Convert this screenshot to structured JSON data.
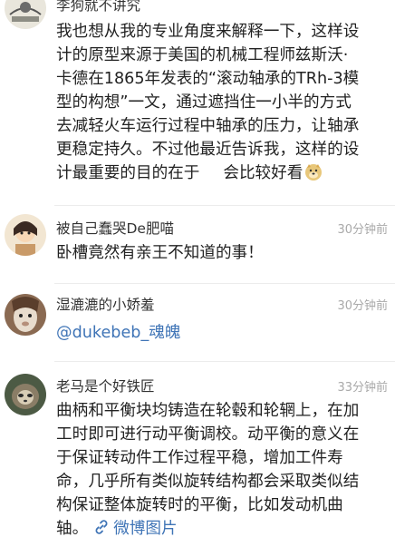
{
  "comments": [
    {
      "user": "李狗就不讲究",
      "lines": [
        "我也想从我的专业角度来解释一下，这样设",
        "计的原型来源于美国的机械工程师兹斯沃·",
        "卡德在1865年发表的“滚动轴承的TRh-3模",
        "型的构想”一文，通过遮挡住一小半的方式",
        "去减轻火车运行过程中轴承的压力，让轴承",
        "更稳定持久。不过他最近告诉我，这样的设",
        "计最重要的目的在于",
        "会比较好看"
      ],
      "emoji": "doge-emoji"
    },
    {
      "user": "被自己蠢哭De肥喵",
      "time": "30分钟前",
      "text": "卧槽竟然有亲王不知道的事！"
    },
    {
      "user": "湿漉漉的小娇羞",
      "time": "30分钟前",
      "mention": "@dukebeb_魂魄"
    },
    {
      "user": "老马是个好铁匠",
      "time": "33分钟前",
      "lines": [
        "曲柄和平衡块均铸造在轮毂和轮辋上，在加",
        "工时即可进行动平衡调校。动平衡的意义在",
        "于保证转动件工作过程平稳，增加工件寿",
        "命，几乎所有类似旋转结构都会采取类似结",
        "构保证整体旋转时的平衡，比如发动机曲",
        "轴。"
      ],
      "link_text": "微博图片",
      "link_icon": "link-icon"
    }
  ],
  "colors": {
    "text": "#222222",
    "name": "#333333",
    "time": "#a9a9a9",
    "link": "#3f74b6",
    "divider": "#ececec"
  }
}
